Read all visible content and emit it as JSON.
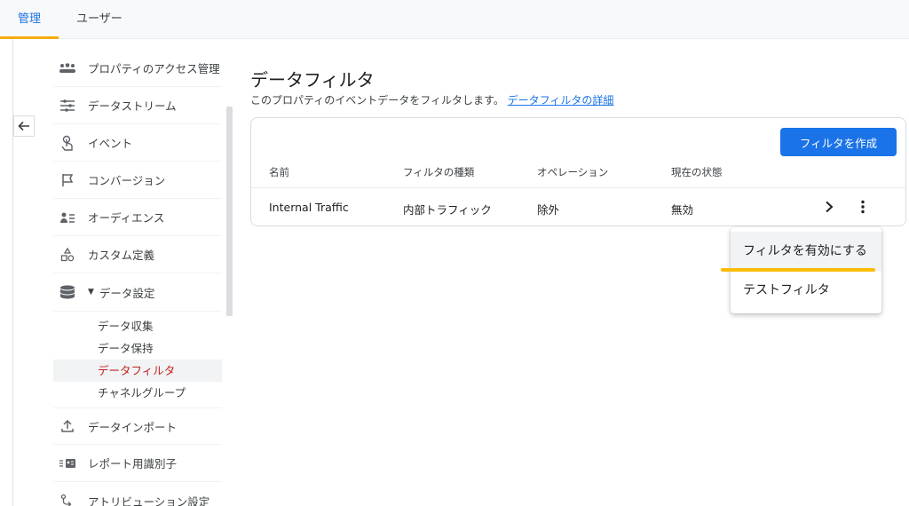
{
  "tabs": [
    {
      "label": "管理",
      "active": true
    },
    {
      "label": "ユーザー",
      "active": false
    }
  ],
  "sidebar": {
    "items": [
      {
        "label": "プロパティのアクセス管理",
        "icon": "people-icon"
      },
      {
        "label": "データストリーム",
        "icon": "streams-icon"
      },
      {
        "label": "イベント",
        "icon": "touch-icon"
      },
      {
        "label": "コンバージョン",
        "icon": "flag-icon"
      },
      {
        "label": "オーディエンス",
        "icon": "audience-icon"
      },
      {
        "label": "カスタム定義",
        "icon": "shapes-icon"
      },
      {
        "label": "データ設定",
        "icon": "database-icon",
        "expanded": true
      }
    ],
    "sub_items": [
      {
        "label": "データ収集"
      },
      {
        "label": "データ保持"
      },
      {
        "label": "データフィルタ",
        "selected": true
      },
      {
        "label": "チャネルグループ"
      }
    ],
    "items_after": [
      {
        "label": "データインポート",
        "icon": "upload-icon"
      },
      {
        "label": "レポート用識別子",
        "icon": "identity-icon"
      },
      {
        "label": "アトリビューション設定",
        "icon": "attribution-icon"
      }
    ]
  },
  "main": {
    "title": "データフィルタ",
    "subtitle": "このプロパティのイベントデータをフィルタします。",
    "subtitle_link": "データフィルタの詳細",
    "create_button": "フィルタを作成",
    "columns": [
      "名前",
      "フィルタの種類",
      "オペレーション",
      "現在の状態"
    ],
    "rows": [
      {
        "name": "Internal Traffic",
        "type": "内部トラフィック",
        "operation": "除外",
        "status": "無効"
      }
    ]
  },
  "menu": {
    "items": [
      "フィルタを有効にする",
      "テストフィルタ"
    ]
  },
  "colors": {
    "accent": "#1a73e8",
    "tab_underline": "#f9ab00",
    "highlight": "#fbbc04",
    "selected_text": "#c5221f"
  }
}
